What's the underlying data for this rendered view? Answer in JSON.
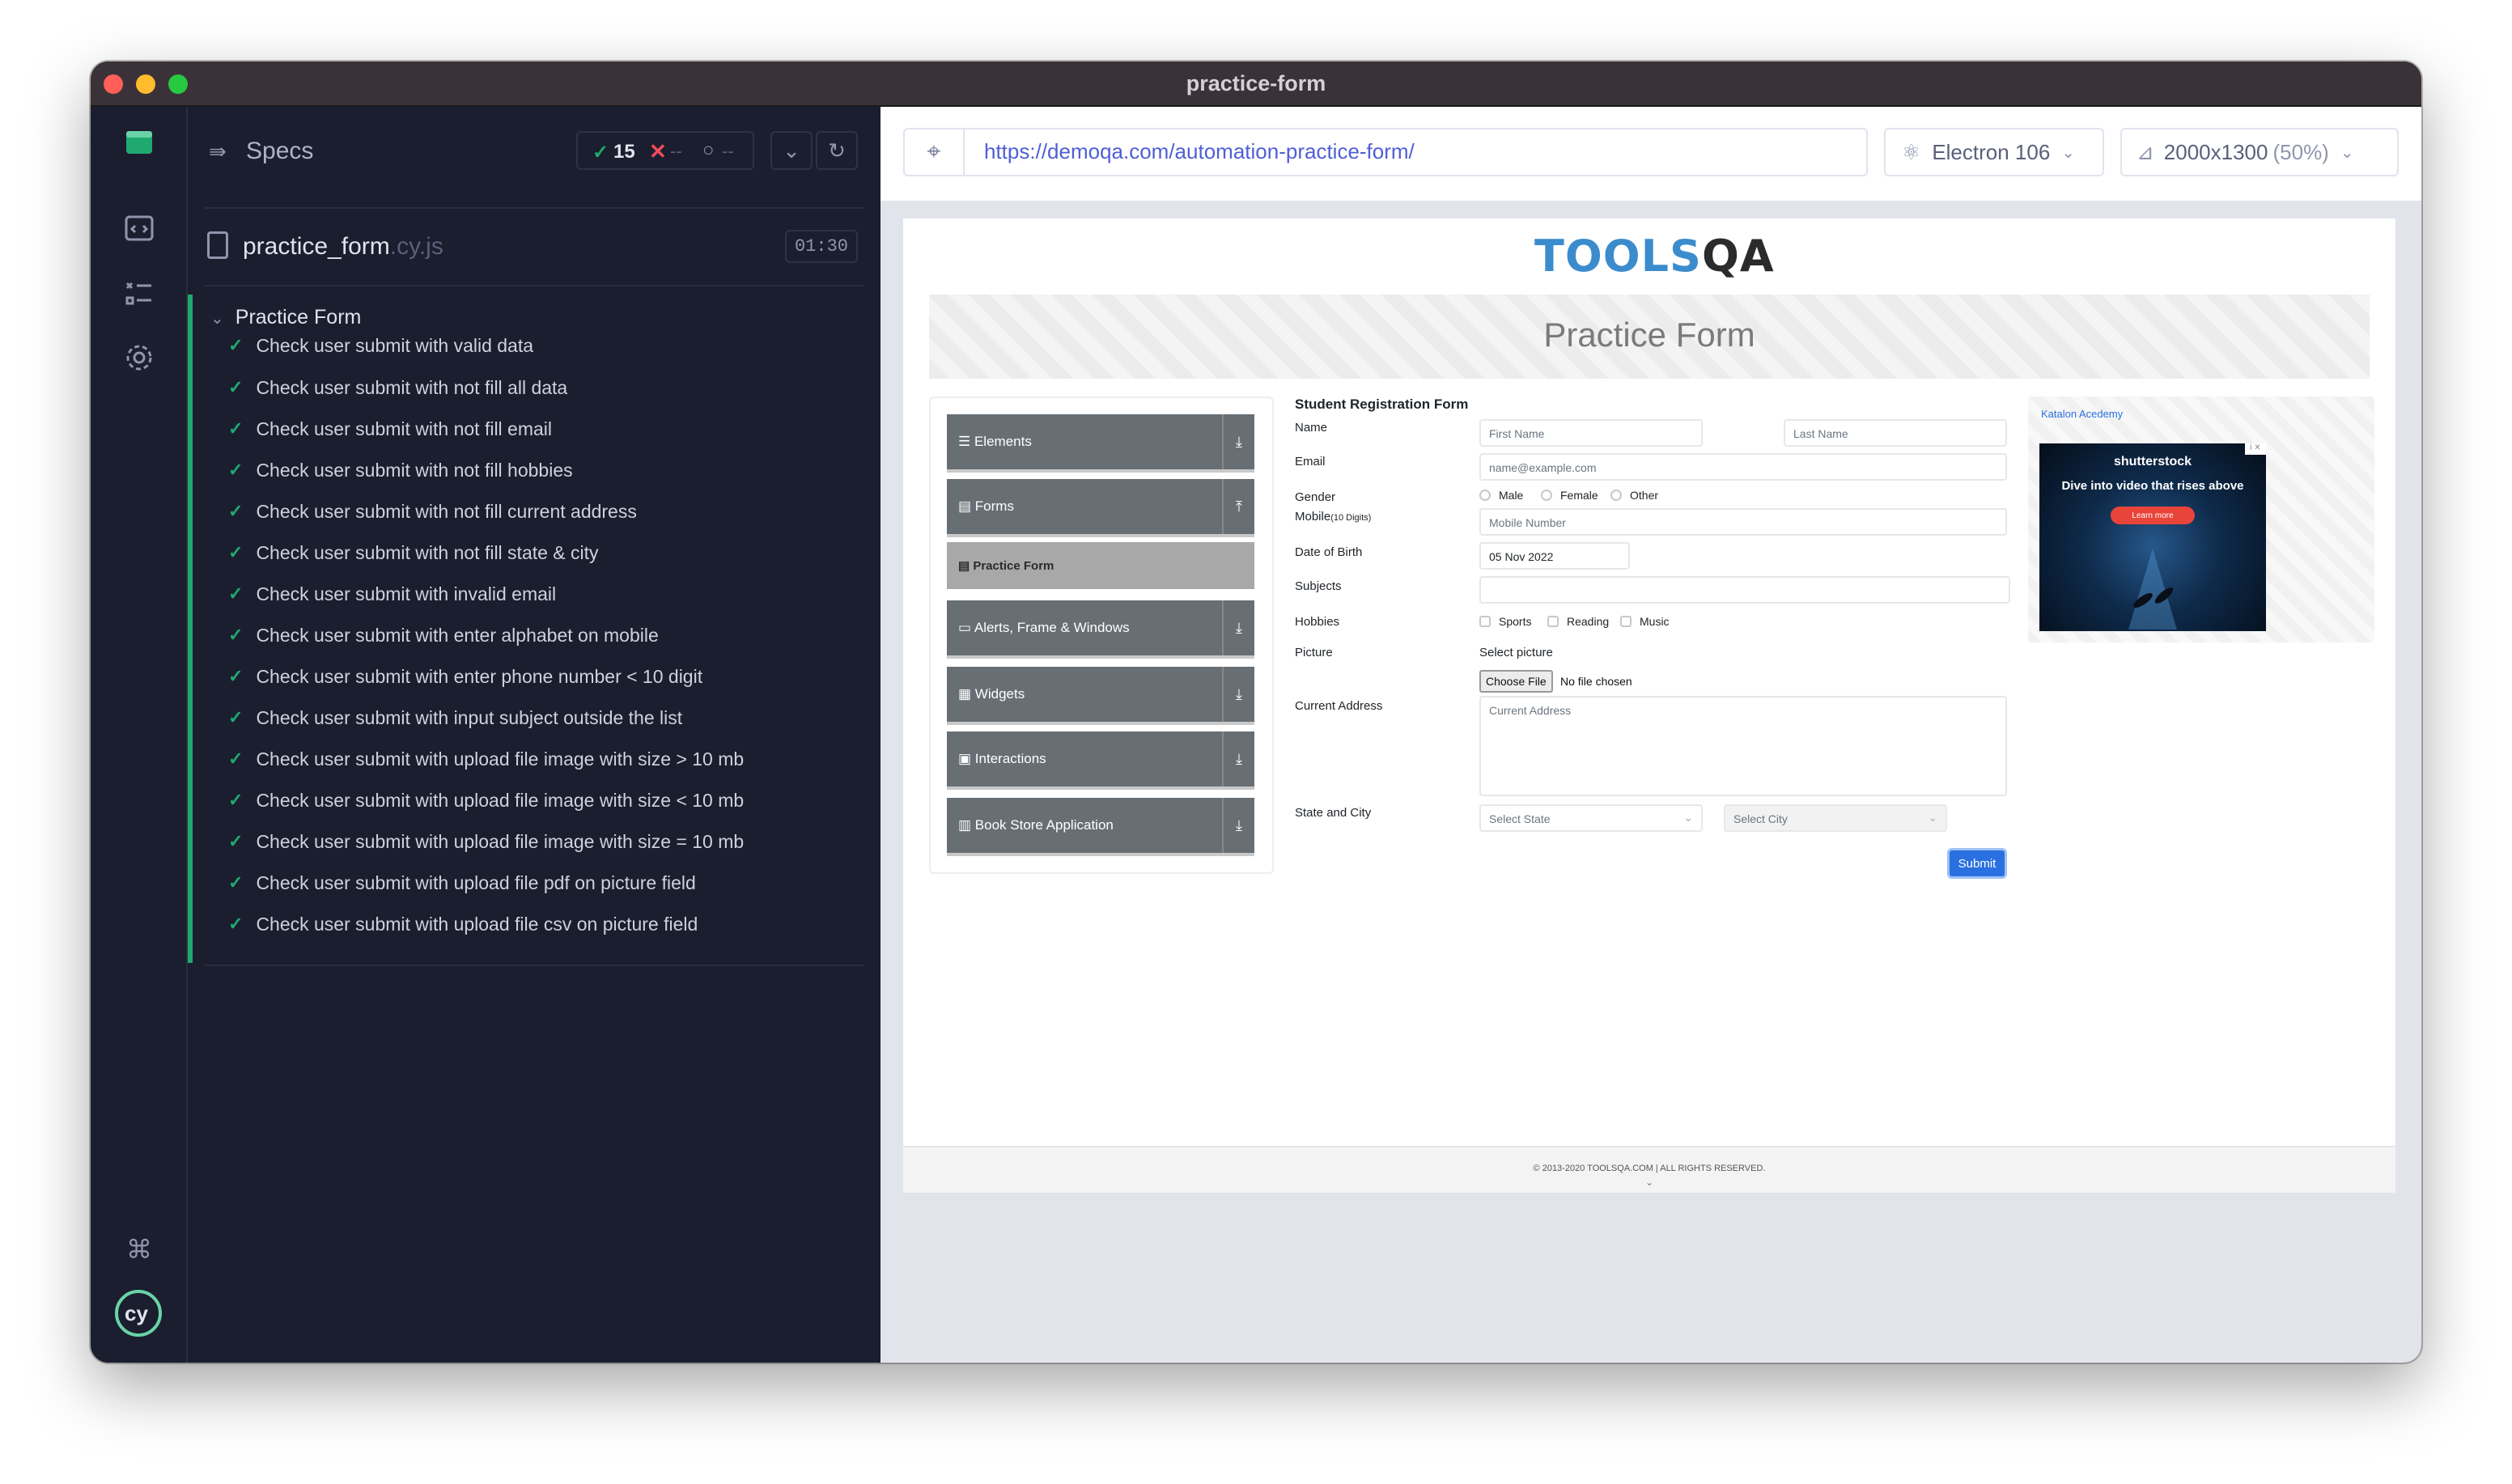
{
  "window": {
    "title": "practice-form"
  },
  "sidebar": {
    "icons": [
      "app-logo-icon",
      "specs-list-icon",
      "runs-icon",
      "settings-icon",
      "keyboard-shortcut-icon",
      "cypress-logo-icon"
    ]
  },
  "reporter": {
    "header_label": "Specs",
    "stats": {
      "passed": "15",
      "failed": "--",
      "pending": "--"
    },
    "spec_file": {
      "name": "practice_form",
      "ext": ".cy.js",
      "duration": "01:30"
    },
    "suite_title": "Practice Form",
    "tests": [
      "Check user submit with valid data",
      "Check user submit with not fill all data",
      "Check user submit with not fill email",
      "Check user submit with not fill hobbies",
      "Check user submit with not fill current address",
      "Check user submit with not fill state & city",
      "Check user submit with invalid email",
      "Check user submit with enter alphabet on mobile",
      "Check user submit with enter phone number < 10 digit",
      "Check user submit with input subject outside the list",
      "Check user submit with upload file image with size > 10 mb",
      "Check user submit with upload file image with size < 10 mb",
      "Check user submit with upload file image with size = 10 mb",
      "Check user submit with upload file pdf on picture field",
      "Check user submit with upload file csv on picture field"
    ]
  },
  "toolbar": {
    "url": "https://demoqa.com/automation-practice-form/",
    "browser": "Electron 106",
    "viewport": "2000x1300",
    "viewport_scale": "(50%)"
  },
  "site": {
    "logo_part1": "TOOLS",
    "logo_part2": "QA",
    "banner_title": "Practice Form",
    "nav": {
      "elements": "Elements",
      "forms": "Forms",
      "practice_form": "Practice Form",
      "alerts": "Alerts, Frame & Windows",
      "widgets": "Widgets",
      "interactions": "Interactions",
      "book_store": "Book Store Application"
    },
    "form": {
      "title": "Student Registration Form",
      "name_label": "Name",
      "first_name_placeholder": "First Name",
      "last_name_placeholder": "Last Name",
      "email_label": "Email",
      "email_placeholder": "name@example.com",
      "gender_label": "Gender",
      "gender_options": [
        "Male",
        "Female",
        "Other"
      ],
      "mobile_label": "Mobile",
      "mobile_hint": "(10 Digits)",
      "mobile_placeholder": "Mobile Number",
      "dob_label": "Date of Birth",
      "dob_value": "05 Nov 2022",
      "subjects_label": "Subjects",
      "hobbies_label": "Hobbies",
      "hobbies_options": [
        "Sports",
        "Reading",
        "Music"
      ],
      "picture_label": "Picture",
      "picture_select": "Select picture",
      "choose_file": "Choose File",
      "no_file": "No file chosen",
      "address_label": "Current Address",
      "address_placeholder": "Current Address",
      "state_city_label": "State and City",
      "state_placeholder": "Select State",
      "city_placeholder": "Select City",
      "submit": "Submit"
    },
    "ad": {
      "link_text": "Katalon Acedemy",
      "brand": "shutterstock",
      "headline": "Dive into video that rises above",
      "cta": "Learn more"
    },
    "footer": "© 2013-2020 TOOLSQA.COM | ALL RIGHTS RESERVED."
  }
}
